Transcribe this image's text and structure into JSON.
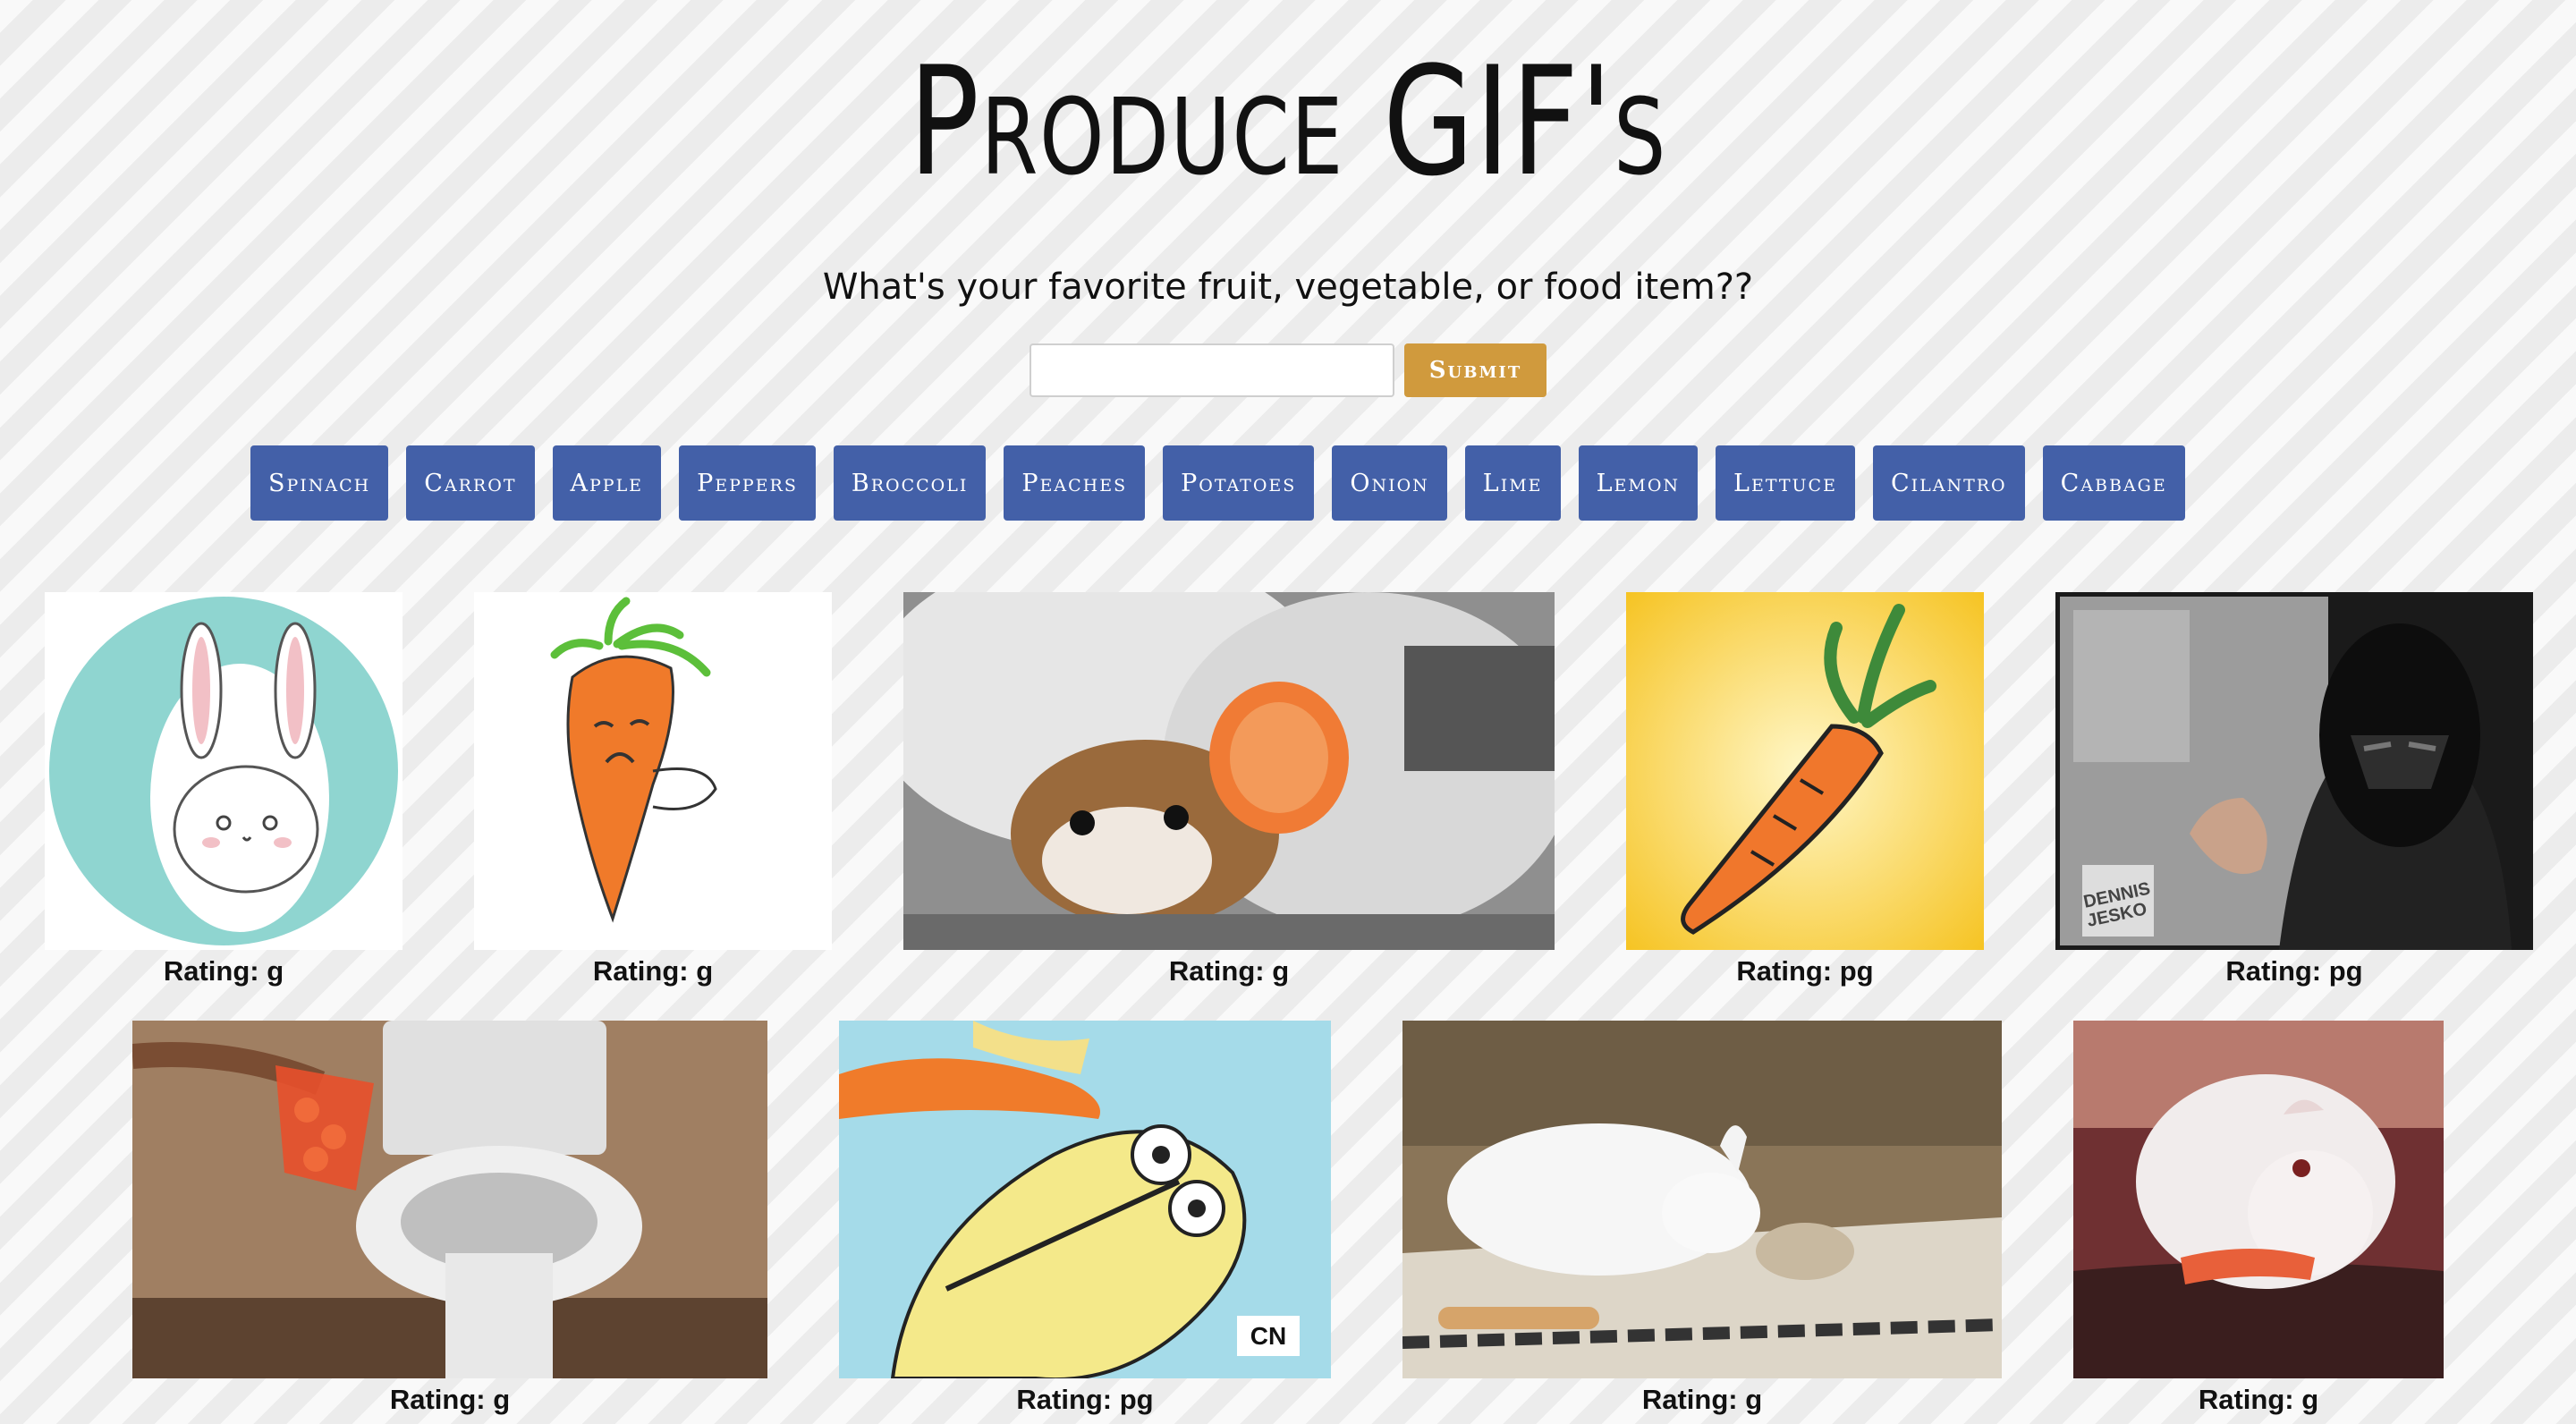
{
  "header": {
    "title": "Produce GIF's",
    "subtitle": "What's your favorite fruit, vegetable, or food item??"
  },
  "search": {
    "value": "",
    "placeholder": "",
    "submit_label": "Submit"
  },
  "produce_buttons": [
    "Spinach",
    "Carrot",
    "Apple",
    "Peppers",
    "Broccoli",
    "Peaches",
    "Potatoes",
    "Onion",
    "Lime",
    "Lemon",
    "Lettuce",
    "Cilantro",
    "Cabbage"
  ],
  "gifs": [
    {
      "subject": "bunny-icon",
      "rating": "Rating: g"
    },
    {
      "subject": "crying-carrot-icon",
      "rating": "Rating: g"
    },
    {
      "subject": "hamster-with-carrot",
      "rating": "Rating: g"
    },
    {
      "subject": "carrot-drawing",
      "rating": "Rating: pg"
    },
    {
      "subject": "darth-vader",
      "rating": "Rating: pg"
    },
    {
      "subject": "carrots-in-toilet",
      "rating": "Rating: g"
    },
    {
      "subject": "cartoon-character-carrot",
      "rating": "Rating: pg"
    },
    {
      "subject": "rabbit-and-hamster",
      "rating": "Rating: g"
    },
    {
      "subject": "guinea-pig-eating-carrot",
      "rating": "Rating: g"
    }
  ],
  "colors": {
    "submit": "#d09a3d",
    "produce_button": "#4360a8"
  }
}
